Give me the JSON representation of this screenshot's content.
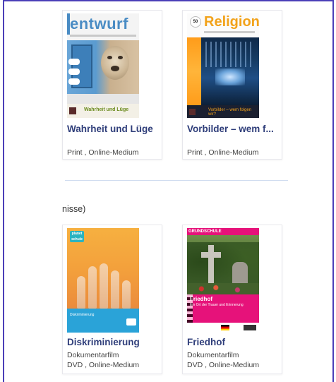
{
  "sections": {
    "section_label": "nisse)"
  },
  "cards": [
    {
      "title": "Wahrheit und Lüge",
      "type": "",
      "formats": "Print , Online-Medium",
      "cover": {
        "logo": "entwurf",
        "bottom_text": "Wahrheit und Lüge"
      }
    },
    {
      "title": "Vorbilder – wem f...",
      "type": "",
      "formats": "Print , Online-Medium",
      "cover": {
        "issue": "50",
        "logo": "Religion",
        "bottom_text": "Vorbilder – wem folgen wir?"
      }
    },
    {
      "title": "Diskriminierung",
      "type": "Dokumentarfilm",
      "formats": "DVD , Online-Medium",
      "cover": {
        "tag": "planet schule",
        "band_text": "Diskriminierung"
      }
    },
    {
      "title": "Friedhof",
      "type": "Dokumentarfilm",
      "formats": "DVD , Online-Medium",
      "cover": {
        "top_text": "GRUNDSCHULE",
        "title": "Friedhof",
        "subtitle": "Ein Ort der Trauer und Erinnerung"
      }
    }
  ],
  "colors": {
    "frame": "#4b3fb8",
    "title": "#2f3e7a",
    "divider": "#cfdcef"
  }
}
